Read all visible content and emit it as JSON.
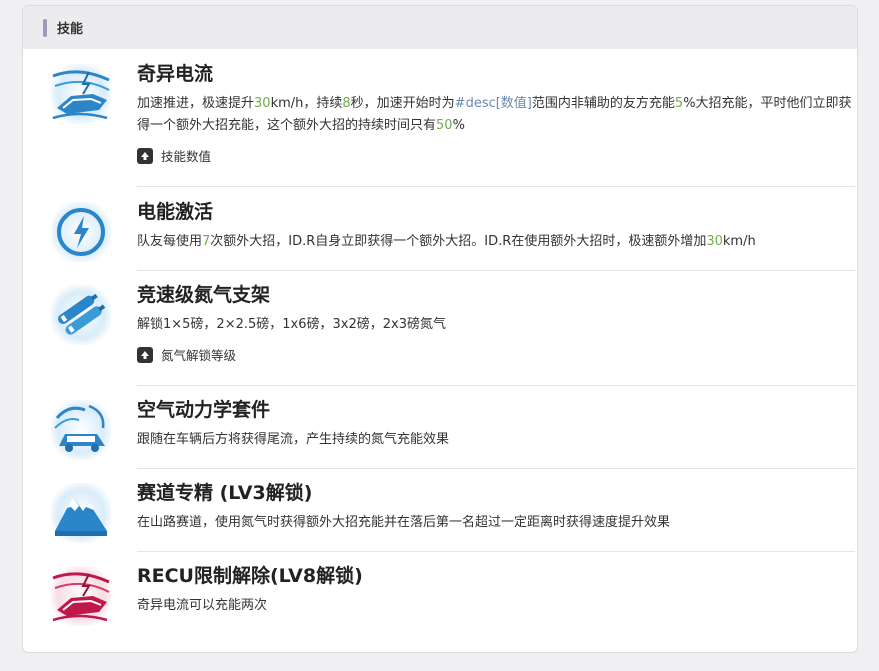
{
  "header": {
    "title": "技能"
  },
  "skills": [
    {
      "name": "奇异电流",
      "desc": [
        {
          "t": "加速推进，极速提升"
        },
        {
          "t": "30",
          "c": "num"
        },
        {
          "t": "km/h，持续"
        },
        {
          "t": "8",
          "c": "num"
        },
        {
          "t": "秒，加速开始时为"
        },
        {
          "t": "#desc[数值]",
          "c": "link"
        },
        {
          "t": "范围内非辅助的友方充能"
        },
        {
          "t": "5",
          "c": "num"
        },
        {
          "t": "%大招充能，平时他们立即获得一个额外大招充能，这个额外大招的持续时间只有"
        },
        {
          "t": "50",
          "c": "num"
        },
        {
          "t": "%"
        }
      ],
      "expander": "技能数值",
      "icon": "electric-current-icon"
    },
    {
      "name": "电能激活",
      "desc": [
        {
          "t": "队友每使用"
        },
        {
          "t": "7",
          "c": "num"
        },
        {
          "t": "次额外大招，ID.R自身立即获得一个额外大招。ID.R在使用额外大招时，极速额外增加"
        },
        {
          "t": "30",
          "c": "num"
        },
        {
          "t": "km/h"
        }
      ],
      "icon": "power-activation-icon"
    },
    {
      "name": "竞速级氮气支架",
      "desc": [
        {
          "t": "解锁1×5磅，2×2.5磅，1x6磅，3x2磅，2x3磅氮气"
        }
      ],
      "expander": "氮气解锁等级",
      "icon": "nitro-tanks-icon"
    },
    {
      "name": "空气动力学套件",
      "desc": [
        {
          "t": "跟随在车辆后方将获得尾流，产生持续的氮气充能效果"
        }
      ],
      "icon": "aero-kit-icon"
    },
    {
      "name": "赛道专精 (LV3解锁)",
      "desc": [
        {
          "t": "在山路赛道，使用氮气时获得额外大招充能并在落后第一名超过一定距离时获得速度提升效果"
        }
      ],
      "icon": "mountain-icon"
    },
    {
      "name": "RECU限制解除(LV8解锁)",
      "desc": [
        {
          "t": "奇异电流可以充能两次"
        }
      ],
      "icon": "recu-unlock-icon"
    }
  ],
  "colors": {
    "number": "#6fae4a",
    "link": "#6a8ab0",
    "icon_blue": "#2a86c8",
    "icon_red": "#c0184a"
  }
}
